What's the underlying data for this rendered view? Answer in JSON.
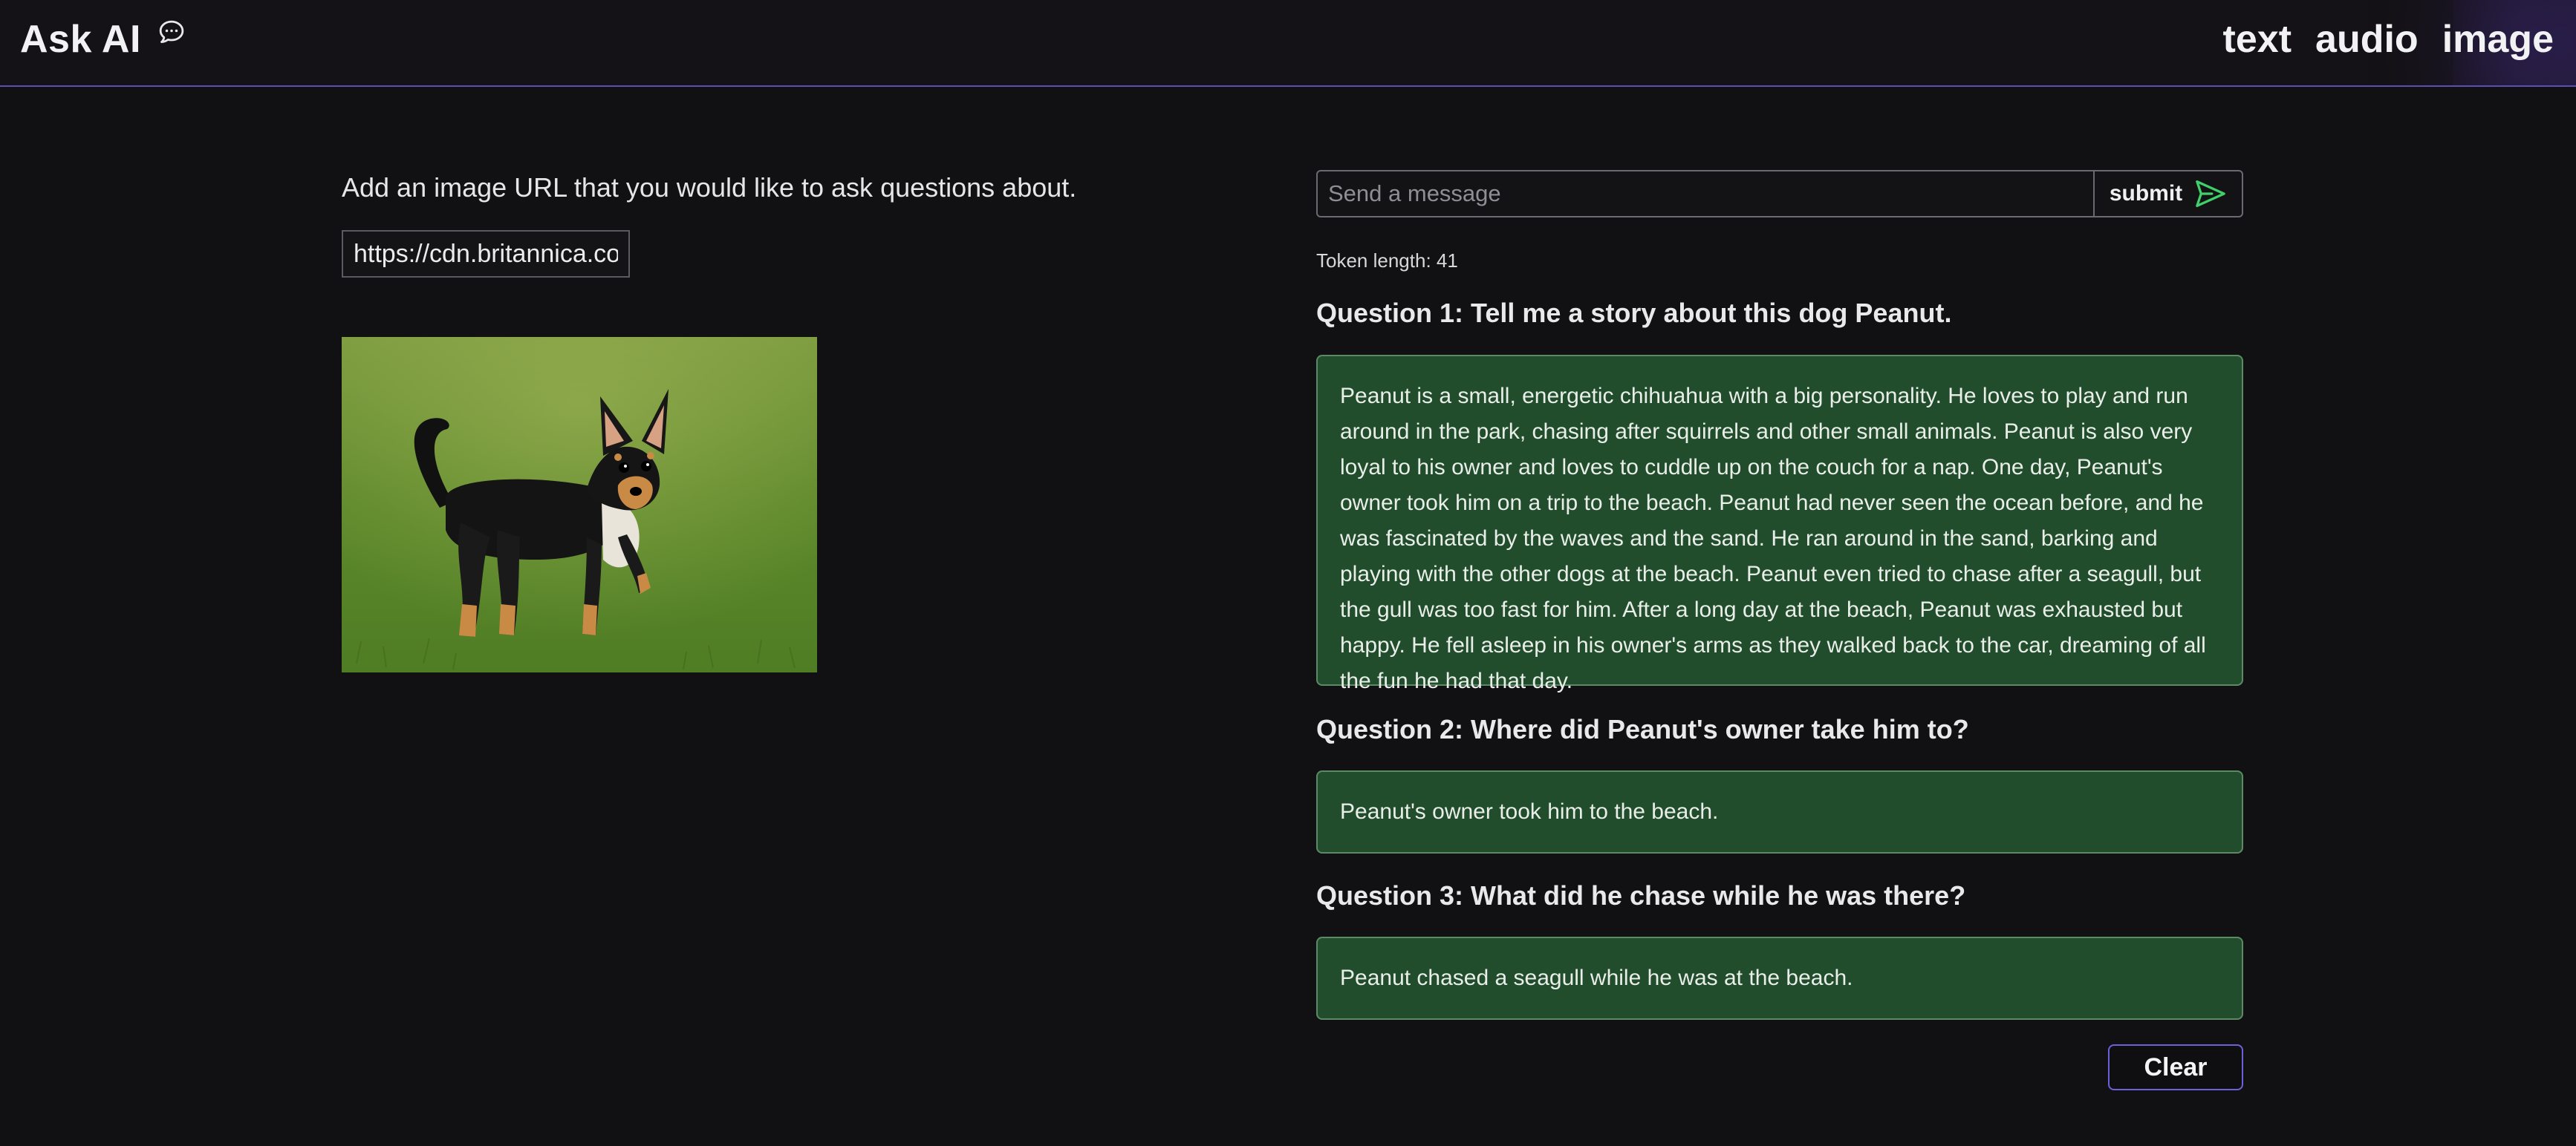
{
  "header": {
    "title": "Ask AI",
    "icon": "chat-bubble-icon",
    "nav": [
      {
        "label": "text"
      },
      {
        "label": "audio"
      },
      {
        "label": "image"
      }
    ]
  },
  "image_panel": {
    "prompt": "Add an image URL that you would like to ask questions about.",
    "url_value": "https://cdn.britannica.co",
    "image_subject": "black and tan chihuahua standing on grass"
  },
  "chat": {
    "input_placeholder": "Send a message",
    "submit_label": "submit",
    "token_length": "Token length: 41",
    "qa": [
      {
        "question": "Question 1: Tell me a story about this dog Peanut.",
        "answer": "Peanut is a small, energetic chihuahua with a big personality. He loves to play and run around in the park, chasing after squirrels and other small animals. Peanut is also very loyal to his owner and loves to cuddle up on the couch for a nap. One day, Peanut's owner took him on a trip to the beach. Peanut had never seen the ocean before, and he was fascinated by the waves and the sand. He ran around in the sand, barking and playing with the other dogs at the beach. Peanut even tried to chase after a seagull, but the gull was too fast for him. After a long day at the beach, Peanut was exhausted but happy. He fell asleep in his owner's arms as they walked back to the car, dreaming of all the fun he had that day."
      },
      {
        "question": "Question 2: Where did Peanut's owner take him to?",
        "answer": "Peanut's owner took him to the beach."
      },
      {
        "question": "Question 3: What did he chase while he was there?",
        "answer": "Peanut chased a seagull while he was at the beach."
      }
    ],
    "clear_label": "Clear"
  },
  "colors": {
    "background": "#111113",
    "answer_bg": "#214d2d",
    "answer_border": "#5d8a66",
    "accent": "#6c62d8",
    "send_icon": "#3fd06a"
  }
}
